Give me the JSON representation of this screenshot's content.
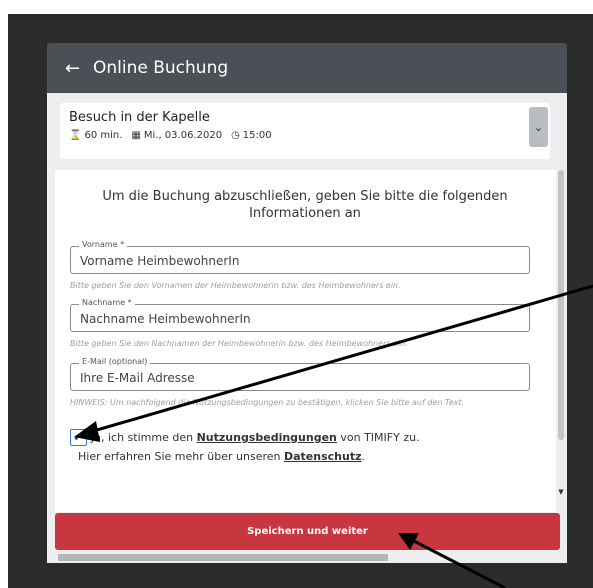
{
  "header": {
    "back_icon": "←",
    "title": "Online Buchung"
  },
  "event": {
    "name": "Besuch in der Kapelle",
    "duration_icon": "⌛",
    "duration": "60 min.",
    "date_icon": "▦",
    "date": "Mi., 03.06.2020",
    "time_icon": "◷",
    "time": "15:00",
    "dropdown_icon": "⌄"
  },
  "form": {
    "intro": "Um die Buchung abzuschließen, geben Sie bitte die folgenden Informationen an",
    "first_name": {
      "label": "Vorname *",
      "placeholder": "Vorname HeimbewohnerIn",
      "hint": "Bitte geben Sie den Vornamen der Heimbewohnerin bzw. des Heimbewohners ein."
    },
    "last_name": {
      "label": "Nachname *",
      "placeholder": "Nachname HeimbewohnerIn",
      "hint": "Bitte geben Sie den Nachnamen der Heimbewohnerin bzw. des Heimbewohners ein."
    },
    "email": {
      "label": "E-Mail (optional)",
      "placeholder": "Ihre E-Mail Adresse",
      "hint": "HINWEIS: Um nachfolgend die Nutzungsbedingungen zu bestätigen, klicken Sie bitte auf den Text."
    },
    "terms": {
      "checked": true,
      "check_icon": "✔",
      "prefix": "Ja, ich stimme den ",
      "link": "Nutzungsbedingungen",
      "suffix": " von TIMIFY zu."
    },
    "privacy": {
      "prefix": "Hier erfahren Sie mehr über unseren ",
      "link": "Datenschutz",
      "suffix": "."
    },
    "scroll_arrow_icon": "▼"
  },
  "save_button": {
    "label": "Speichern und weiter",
    "color": "#c8363f"
  },
  "colors": {
    "header": "#4b5056",
    "panel": "#eceeef",
    "backdrop": "#2b2b2b"
  }
}
